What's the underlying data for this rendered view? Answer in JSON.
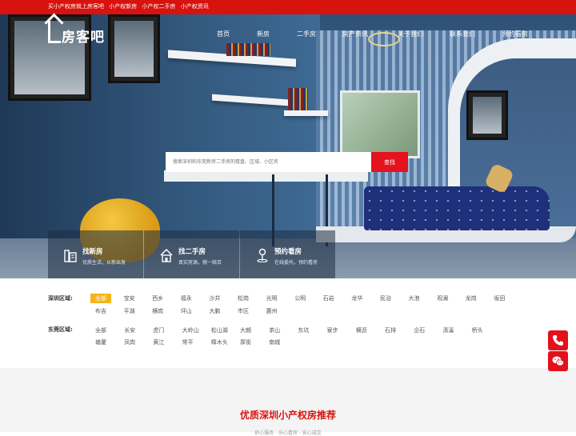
{
  "topbar": {
    "links": [
      "买小产权房就上房客吧",
      "小产权新房",
      "小产权二手房",
      "小产权资讯"
    ]
  },
  "logo": {
    "text": "房客吧"
  },
  "nav": {
    "items": [
      "首页",
      "新房",
      "二手房",
      "房产资讯",
      "关于我们",
      "联系我们",
      "预约看房"
    ]
  },
  "search": {
    "placeholder": "搜索深圳和东莞新房二手房的楼盘、区域、小区名",
    "button_label": "查找"
  },
  "features": [
    {
      "title": "找新房",
      "subtitle": "优质生活，从新出发",
      "icon": "building-icon"
    },
    {
      "title": "找二手房",
      "subtitle": "真实房源，假一赔百",
      "icon": "house-icon"
    },
    {
      "title": "预约看房",
      "subtitle": "在线委托，预约看房",
      "icon": "person-pin-icon"
    }
  ],
  "areas": {
    "shenzhen": {
      "label": "深圳区域:",
      "row1": [
        "全部",
        "宝安",
        "西乡",
        "福永",
        "沙井",
        "松岗",
        "光明",
        "公明",
        "石岩",
        "龙华",
        "民治",
        "大浪",
        "观澜",
        "龙岗",
        "坂田"
      ],
      "row2": [
        "布吉",
        "平湖",
        "横岗",
        "坪山",
        "大鹏",
        "市区",
        "惠州"
      ]
    },
    "dongguan": {
      "label": "东莞区域:",
      "row1": [
        "全部",
        "长安",
        "虎门",
        "大岭山",
        "松山湖",
        "大朗",
        "茶山",
        "东坑",
        "寮步",
        "横沥",
        "石排",
        "企石",
        "清溪",
        "桥头"
      ],
      "row2": [
        "塘厦",
        "凤岗",
        "黄江",
        "常平",
        "樟木头",
        "厚街",
        "南城"
      ]
    }
  },
  "section": {
    "title": "优质深圳小产权房推荐",
    "subtitle": "舒心服务 · 乐心看房 · 安心成交"
  },
  "colors": {
    "brand_red": "#d8120e",
    "active_tag": "#f6b415"
  }
}
